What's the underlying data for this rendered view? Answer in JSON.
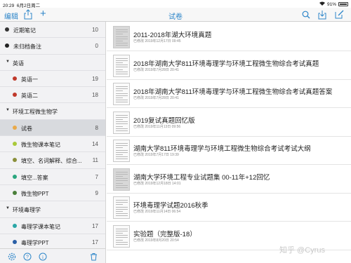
{
  "status": {
    "time": "20:29",
    "date": "6月2日周二",
    "battery": "91%"
  },
  "nav": {
    "edit": "编辑",
    "plus": "+",
    "title": "试卷"
  },
  "sidebar": {
    "rows": [
      {
        "label": "近期笔记",
        "count": "10",
        "dot": "#333333",
        "indent": 1,
        "type": "item"
      },
      {
        "label": "未归档备注",
        "count": "0",
        "dot": "#222222",
        "indent": 1,
        "type": "item"
      },
      {
        "label": "英语",
        "count": "",
        "dot": "",
        "indent": 0,
        "type": "group"
      },
      {
        "label": "英语一",
        "count": "19",
        "dot": "#c0392b",
        "indent": 2,
        "type": "item"
      },
      {
        "label": "英语二",
        "count": "18",
        "dot": "#c0392b",
        "indent": 2,
        "type": "item"
      },
      {
        "label": "环境工程微生物学",
        "count": "",
        "dot": "",
        "indent": 0,
        "type": "group"
      },
      {
        "label": "试卷",
        "count": "8",
        "dot": "#e9a94a",
        "indent": 2,
        "type": "item",
        "selected": true
      },
      {
        "label": "微生物课本笔记",
        "count": "14",
        "dot": "#a9c93a",
        "indent": 2,
        "type": "item"
      },
      {
        "label": "填空、名词解释、综合...",
        "count": "11",
        "dot": "#8a8f3a",
        "indent": 2,
        "type": "item"
      },
      {
        "label": "填空...答案",
        "count": "7",
        "dot": "#2aa67e",
        "indent": 2,
        "type": "item"
      },
      {
        "label": "微生物PPT",
        "count": "9",
        "dot": "#4a7f3a",
        "indent": 2,
        "type": "item"
      },
      {
        "label": "环境毒理学",
        "count": "",
        "dot": "",
        "indent": 0,
        "type": "group"
      },
      {
        "label": "毒理学课本笔记",
        "count": "17",
        "dot": "#2aa6a6",
        "indent": 2,
        "type": "item"
      },
      {
        "label": "毒理学PPT",
        "count": "17",
        "dot": "#2a5fa6",
        "indent": 2,
        "type": "item"
      }
    ]
  },
  "list": [
    {
      "title": "2011-2018年湖大环境真题",
      "date": "已修改 2019年12月17日 09:45",
      "dark": true
    },
    {
      "title": "2018年湖南大学811环境毒理学与环境工程微生物综合考试真题",
      "date": "已修改 2019年7月28日 20:41",
      "dark": false
    },
    {
      "title": "2018年湖南大学811环境毒理学与环境工程微生物综合考试真题答案",
      "date": "已修改 2019年7月28日 20:41",
      "dark": false
    },
    {
      "title": "2019复试真题回忆版",
      "date": "已修改 2019年11月13日 09:56",
      "dark": false
    },
    {
      "title": "湖南大学811环境毒理学与环境工程微生物综合考试考试大纲",
      "date": "已修改 2019年7月17日 19:39",
      "dark": false
    },
    {
      "title": "湖南大学环境工程专业试题集 00-11年+12回忆",
      "date": "已修改 2019年12月18日 14:01",
      "dark": true
    },
    {
      "title": "环境毒理学试题2016秋季",
      "date": "已修改 2019年11月14日 06:54",
      "dark": false
    },
    {
      "title": "实验题（完整版-18）",
      "date": "已修改 2019年8月20日 20:54",
      "dark": false
    }
  ],
  "watermark": "知乎 @Cyrus",
  "colors": {
    "accent": "#2e86c9",
    "selected_row": "#d8dade"
  }
}
